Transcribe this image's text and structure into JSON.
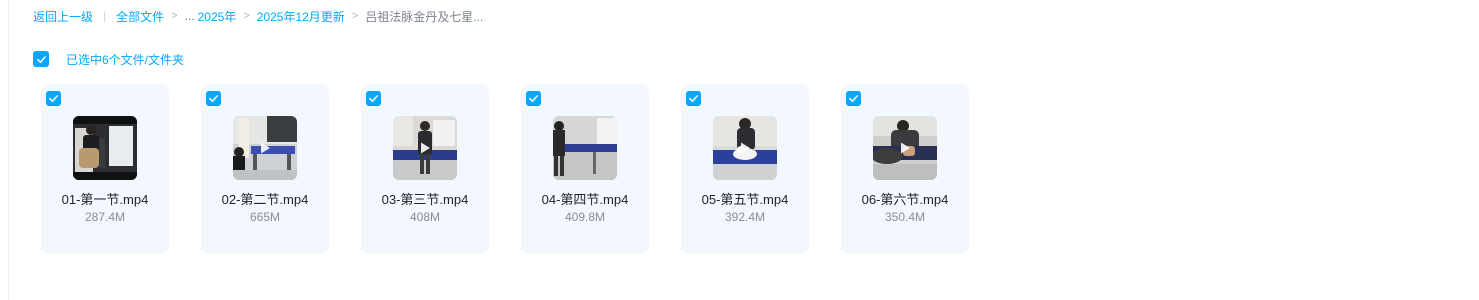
{
  "breadcrumb": {
    "back_label": "返回上一级",
    "all_files_label": "全部文件",
    "ellipsis": "...",
    "items": [
      "2025年",
      "2025年12月更新"
    ],
    "current": "吕祖法脉金丹及七星..."
  },
  "selection": {
    "checked": true,
    "text": "已选中6个文件/文件夹"
  },
  "accent_color": "#06a7ff",
  "files": [
    {
      "name": "01-第一节.mp4",
      "size": "287.4M",
      "checked": true,
      "icon": "video-thumbnail"
    },
    {
      "name": "02-第二节.mp4",
      "size": "665M",
      "checked": true,
      "icon": "video-thumbnail"
    },
    {
      "name": "03-第三节.mp4",
      "size": "408M",
      "checked": true,
      "icon": "video-thumbnail"
    },
    {
      "name": "04-第四节.mp4",
      "size": "409.8M",
      "checked": true,
      "icon": "video-thumbnail"
    },
    {
      "name": "05-第五节.mp4",
      "size": "392.4M",
      "checked": true,
      "icon": "video-thumbnail"
    },
    {
      "name": "06-第六节.mp4",
      "size": "350.4M",
      "checked": true,
      "icon": "video-thumbnail"
    }
  ]
}
